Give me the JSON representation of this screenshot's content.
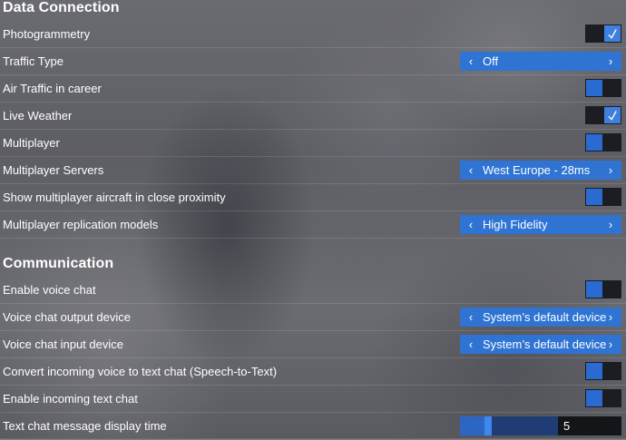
{
  "sections": [
    {
      "title": "Data Connection",
      "rows": [
        {
          "label": "Photogrammetry",
          "control": "toggle",
          "state": "on"
        },
        {
          "label": "Traffic Type",
          "control": "selector",
          "value": "Off"
        },
        {
          "label": "Air Traffic in career",
          "control": "toggle",
          "state": "off"
        },
        {
          "label": "Live Weather",
          "control": "toggle",
          "state": "on"
        },
        {
          "label": "Multiplayer",
          "control": "toggle",
          "state": "off"
        },
        {
          "label": "Multiplayer Servers",
          "control": "selector",
          "value": "West Europe - 28ms"
        },
        {
          "label": "Show multiplayer aircraft in close proximity",
          "control": "toggle",
          "state": "off"
        },
        {
          "label": "Multiplayer replication models",
          "control": "selector",
          "value": "High Fidelity"
        }
      ]
    },
    {
      "title": "Communication",
      "rows": [
        {
          "label": "Enable voice chat",
          "control": "toggle",
          "state": "off"
        },
        {
          "label": "Voice chat output device",
          "control": "selector",
          "value": "System’s default device"
        },
        {
          "label": "Voice chat input device",
          "control": "selector",
          "value": "System’s default device"
        },
        {
          "label": "Convert incoming voice to text chat (Speech-to-Text)",
          "control": "toggle",
          "state": "off"
        },
        {
          "label": "Enable incoming text chat",
          "control": "toggle",
          "state": "off"
        },
        {
          "label": "Text chat message display time",
          "control": "slider",
          "value": "5",
          "fraction": 0.25
        }
      ]
    }
  ],
  "icons": {
    "left_arrow": "chevron-left-icon",
    "right_arrow": "chevron-right-icon",
    "check": "checkmark-icon"
  },
  "colors": {
    "accent": "#2f74d3",
    "toggle_track": "#1c1d22",
    "toggle_knob": "#2a6bd1"
  }
}
